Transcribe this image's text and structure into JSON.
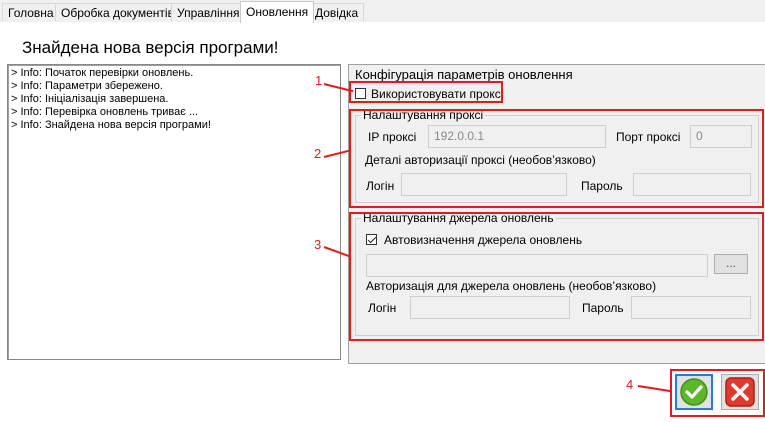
{
  "tabs": [
    {
      "label": "Головна"
    },
    {
      "label": "Обробка документів"
    },
    {
      "label": "Управління"
    },
    {
      "label": "Оновлення"
    },
    {
      "label": "Довідка"
    }
  ],
  "active_tab_index": 3,
  "header": {
    "title": "Знайдена нова версія програми!"
  },
  "log": {
    "lines": [
      "> Info: Початок перевірки оновлень.",
      "> Info: Параметри збережено.",
      "> Info: Ініціалізація завершена.",
      "> Info: Перевірка оновлень триває ...",
      "> Info: Знайдена нова версія програми!"
    ]
  },
  "config": {
    "title": "Конфігурація параметрів оновлення",
    "use_proxy_label": "Використовувати проксі",
    "use_proxy_checked": false,
    "proxy_group": {
      "title": "Налаштування проксі",
      "ip_label": "IP проксі",
      "ip_value": "192.0.0.1",
      "port_label": "Порт проксі",
      "port_value": "0",
      "auth_title": "Деталі авторизації проксі (необов’язково)",
      "login_label": "Логін",
      "login_value": "",
      "password_label": "Пароль",
      "password_value": ""
    },
    "source_group": {
      "title": "Налаштування джерела оновлень",
      "auto_label": "Автовизначення джерела оновлень",
      "auto_checked": true,
      "path_value": "",
      "browse_label": "...",
      "auth_title": "Авторизація для джерела оновлень (необов’язково)",
      "login_label": "Логін",
      "login_value": "",
      "password_label": "Пароль",
      "password_value": ""
    }
  },
  "annotations": {
    "marker1": "1",
    "marker2": "2",
    "marker3": "3",
    "marker4": "4",
    "color": "#e21c1c"
  },
  "actions": {
    "ok_icon": "check-circle-icon",
    "cancel_icon": "close-square-icon",
    "ok_color": "#5cb82a",
    "cancel_color": "#e03a2e"
  }
}
